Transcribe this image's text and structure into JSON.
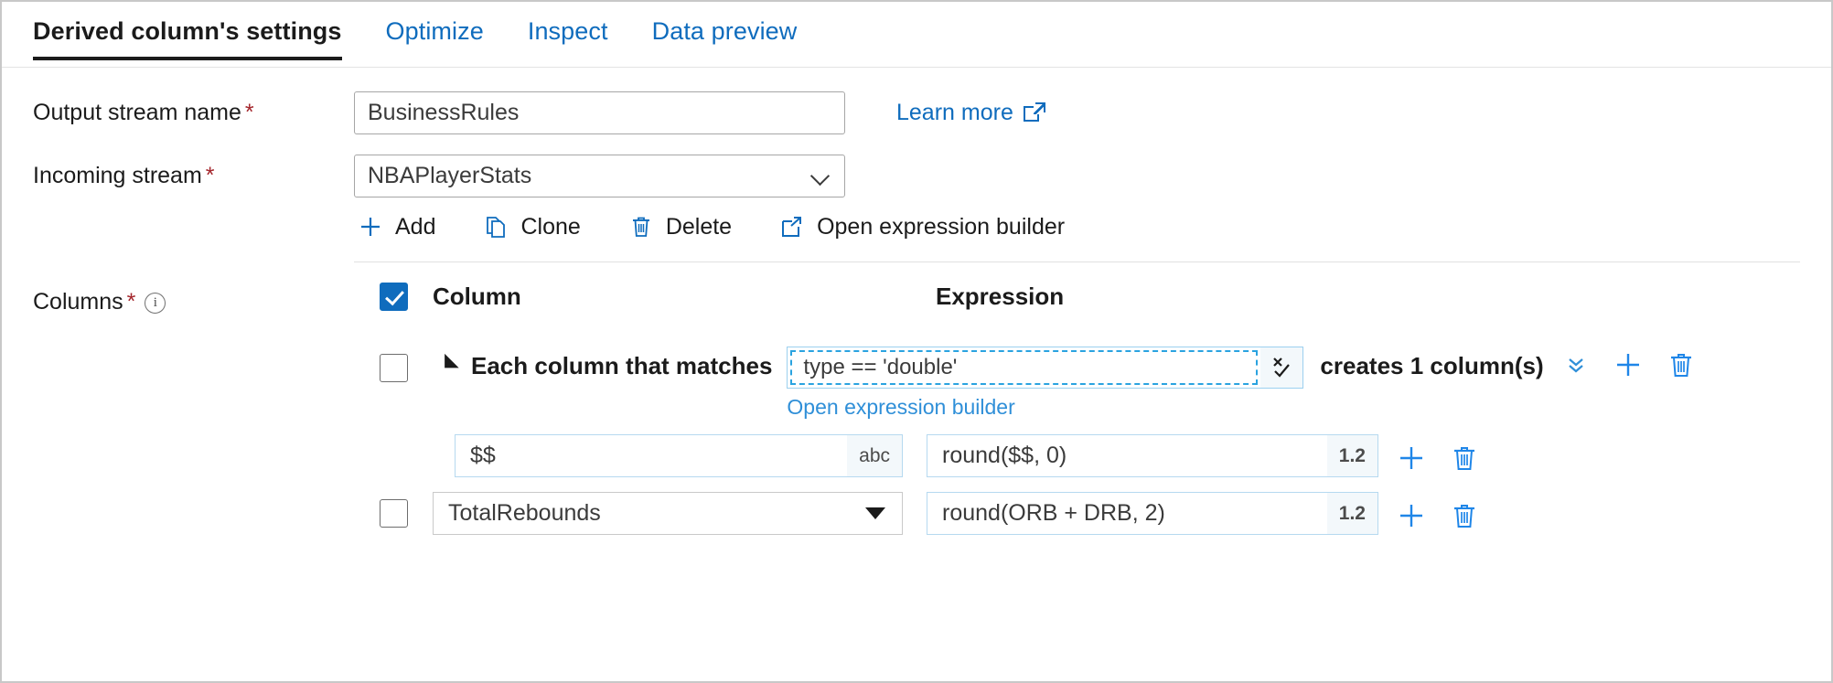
{
  "tabs": [
    {
      "label": "Derived column's settings",
      "active": true
    },
    {
      "label": "Optimize",
      "active": false
    },
    {
      "label": "Inspect",
      "active": false
    },
    {
      "label": "Data preview",
      "active": false
    }
  ],
  "fields": {
    "output_stream": {
      "label": "Output stream name",
      "required": "*",
      "value": "BusinessRules"
    },
    "incoming_stream": {
      "label": "Incoming stream",
      "required": "*",
      "value": "NBAPlayerStats"
    },
    "columns": {
      "label": "Columns",
      "required": "*"
    }
  },
  "learn_more": {
    "label": "Learn more",
    "icon": "external-link-icon"
  },
  "toolbar": [
    {
      "label": "Add",
      "icon": "plus-icon"
    },
    {
      "label": "Clone",
      "icon": "copy-icon"
    },
    {
      "label": "Delete",
      "icon": "trash-icon"
    },
    {
      "label": "Open expression builder",
      "icon": "external-link-icon"
    }
  ],
  "table": {
    "headers": {
      "column": "Column",
      "expression": "Expression"
    },
    "header_checkbox_checked": true,
    "rule_row": {
      "checked": false,
      "prefix_label": "Each column that matches",
      "match_expression": "type == 'double'",
      "sub_link": "Open expression builder",
      "suffix_label": "creates 1 column(s)",
      "editor_icon": "cancel-confirm-icon",
      "expand_icon": "double-chevron-down-icon",
      "add_icon": "plus-icon",
      "delete_icon": "trash-icon"
    },
    "rows": [
      {
        "checked": false,
        "has_checkbox": false,
        "column_value": "$$",
        "column_type_badge": "abc",
        "column_is_dropdown": false,
        "expression_value": "round($$, 0)",
        "expression_type_badge": "1.2",
        "add_icon": "plus-icon",
        "delete_icon": "trash-icon"
      },
      {
        "checked": false,
        "has_checkbox": true,
        "column_value": "TotalRebounds",
        "column_type_badge": "",
        "column_is_dropdown": true,
        "expression_value": "round(ORB + DRB, 2)",
        "expression_type_badge": "1.2",
        "add_icon": "plus-icon",
        "delete_icon": "trash-icon"
      }
    ]
  },
  "colors": {
    "accent": "#0f6cbd",
    "link": "#2f8fd8",
    "required": "#a4262c",
    "text": "#1b1b1b"
  }
}
